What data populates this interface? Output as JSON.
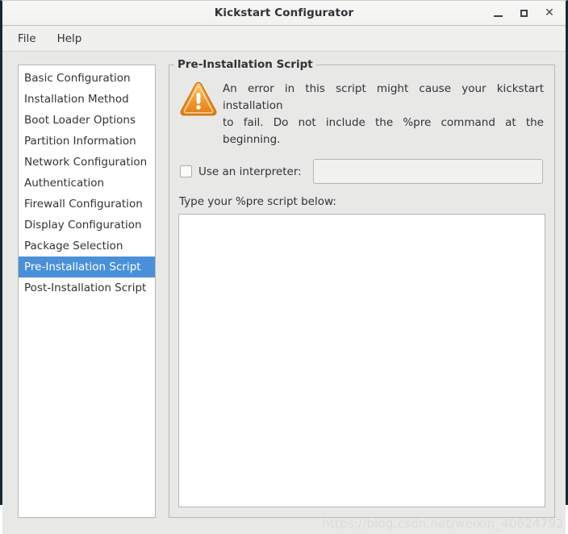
{
  "window": {
    "title": "Kickstart Configurator",
    "controls": {
      "minimize": "minimize-button",
      "maximize": "maximize-button",
      "close": "✕"
    }
  },
  "menubar": {
    "items": [
      {
        "label": "File"
      },
      {
        "label": "Help"
      }
    ]
  },
  "sidebar": {
    "items": [
      {
        "label": "Basic Configuration",
        "selected": false
      },
      {
        "label": "Installation Method",
        "selected": false
      },
      {
        "label": "Boot Loader Options",
        "selected": false
      },
      {
        "label": "Partition Information",
        "selected": false
      },
      {
        "label": "Network Configuration",
        "selected": false
      },
      {
        "label": "Authentication",
        "selected": false
      },
      {
        "label": "Firewall Configuration",
        "selected": false
      },
      {
        "label": "Display Configuration",
        "selected": false
      },
      {
        "label": "Package Selection",
        "selected": false
      },
      {
        "label": "Pre-Installation Script",
        "selected": true
      },
      {
        "label": "Post-Installation Script",
        "selected": false
      }
    ],
    "selection_color": "#4a90d9",
    "selection_text_color": "#ffffff"
  },
  "main": {
    "group_title": "Pre-Installation Script",
    "warning": {
      "icon": "warning-triangle-icon",
      "line1": "An error in this script might cause your kickstart installation",
      "line2": "to fail. Do not include the %pre command at the beginning.",
      "icon_color": "#f08b20"
    },
    "interpreter": {
      "checkbox_checked": false,
      "label": "Use an interpreter:",
      "value": "",
      "placeholder": ""
    },
    "script": {
      "label": "Type your %pre script below:",
      "value": "",
      "placeholder": ""
    }
  },
  "watermark": {
    "text": "https://blog.csdn.net/weixin_40624792"
  }
}
